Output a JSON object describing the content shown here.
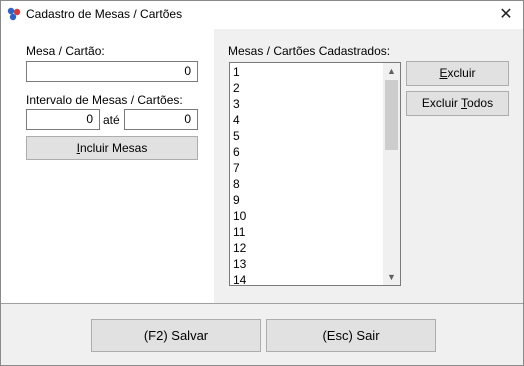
{
  "window": {
    "title": "Cadastro de Mesas / Cartões",
    "close_glyph": "✕"
  },
  "form": {
    "mesa_label": "Mesa / Cartão:",
    "mesa_value": "0",
    "interval_label": "Intervalo de Mesas / Cartões:",
    "interval_from": "0",
    "interval_sep": "até",
    "interval_to": "0",
    "include_button": {
      "before": "",
      "underlined": "I",
      "after": "ncluir Mesas"
    }
  },
  "list": {
    "label": "Mesas / Cartões Cadastrados:",
    "items": [
      "1",
      "2",
      "3",
      "4",
      "5",
      "6",
      "7",
      "8",
      "9",
      "10",
      "11",
      "12",
      "13",
      "14"
    ],
    "scroll_up_glyph": "▲",
    "scroll_down_glyph": "▼"
  },
  "actions": {
    "excluir": {
      "before": "",
      "underlined": "E",
      "after": "xcluir"
    },
    "excluir_todos": {
      "before": "Excluir ",
      "underlined": "T",
      "after": "odos"
    }
  },
  "footer": {
    "save_label": "(F2) Salvar",
    "exit_label": "(Esc) Sair"
  },
  "colors": {
    "title_bar": "#ffffff",
    "panel": "#f0f0f0",
    "button_face": "#e1e1e1"
  }
}
